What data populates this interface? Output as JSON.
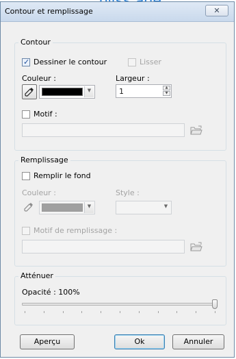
{
  "strip_text": "pliss age",
  "window": {
    "title": "Contour et remplissage",
    "close_glyph": "✕"
  },
  "contour": {
    "legend": "Contour",
    "draw_label": "Dessiner le contour",
    "draw_checked": true,
    "smooth_label": "Lisser",
    "smooth_enabled": false,
    "color_label": "Couleur :",
    "color_value": "#000000",
    "width_label": "Largeur :",
    "width_value": "1",
    "pattern_label": "Motif :",
    "pattern_value": ""
  },
  "fill": {
    "legend": "Remplissage",
    "fill_label": "Remplir le fond",
    "fill_checked": false,
    "color_label": "Couleur :",
    "color_value": "#a0a0a0",
    "style_label": "Style :",
    "style_value": "",
    "pattern_label": "Motif de remplissage :",
    "pattern_value": ""
  },
  "attenuate": {
    "legend": "Atténuer",
    "opacity_label": "Opacité : 100%",
    "opacity_percent": 100
  },
  "buttons": {
    "preview": "Aperçu",
    "ok": "Ok",
    "cancel": "Annuler"
  },
  "icons": {
    "eyedropper": "eyedropper-icon",
    "folder": "folder-open-icon"
  },
  "colors": {
    "accent": "#2a7fd4",
    "border": "#6d8aa6"
  }
}
